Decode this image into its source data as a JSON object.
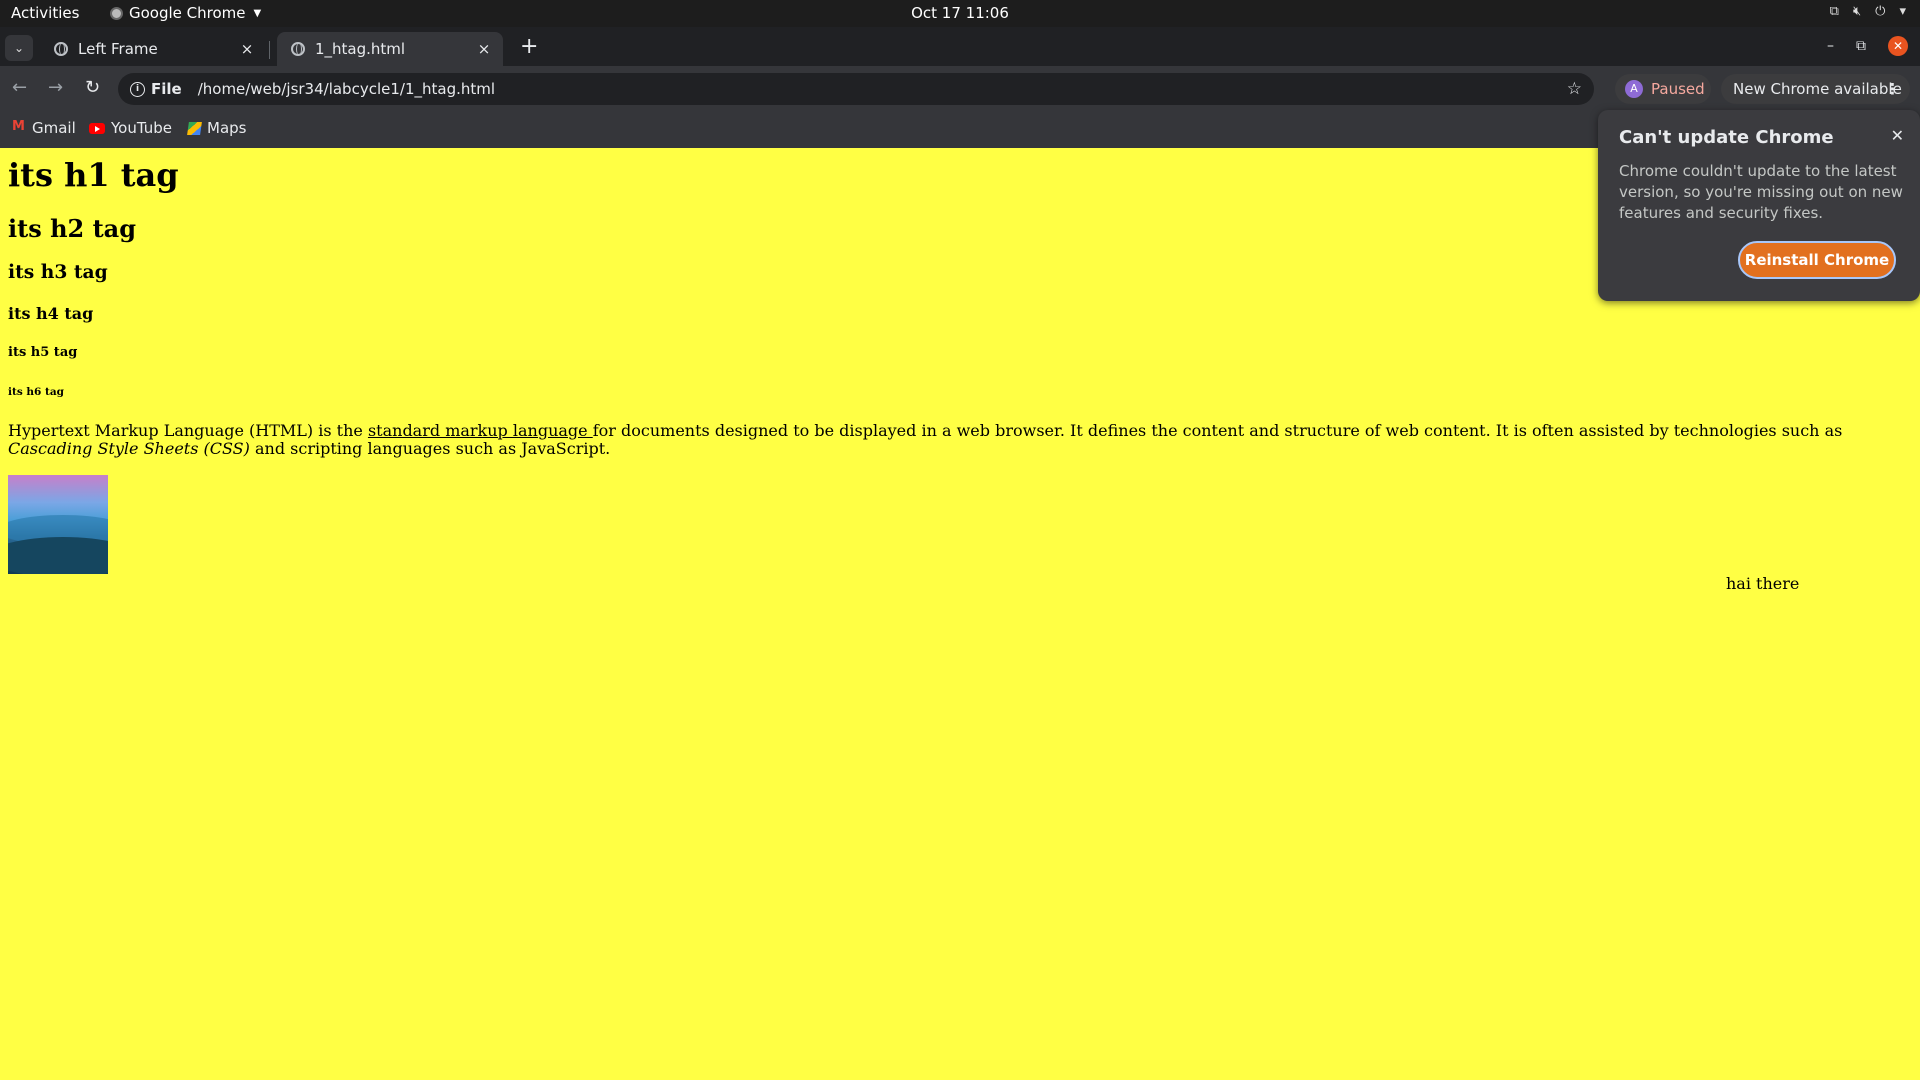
{
  "system_bar": {
    "activities": "Activities",
    "app_name": "Google Chrome",
    "datetime": "Oct 17  11:06"
  },
  "tabs": [
    {
      "title": "Left Frame",
      "close": "×"
    },
    {
      "title": "1_htag.html",
      "close": "×"
    }
  ],
  "toolbar": {
    "scheme": "File",
    "url": "/home/web/jsr34/labcycle1/1_htag.html",
    "profile_initial": "A",
    "profile_status": "Paused",
    "update_label": "New Chrome available"
  },
  "bookmarks": [
    {
      "label": "Gmail"
    },
    {
      "label": "YouTube"
    },
    {
      "label": "Maps"
    }
  ],
  "page": {
    "h1": "its h1 tag",
    "h2": "its h2 tag",
    "h3": "its h3 tag",
    "h4": "its h4 tag",
    "h5": "its h5 tag",
    "h6": "its h6 tag",
    "para_before_link": "Hypertext Markup Language (HTML) is the ",
    "para_link": "standard markup language ",
    "para_middle": "for documents designed to be displayed in a web browser. It defines the content and structure of web content. It is often assisted by technologies such as ",
    "para_italic": "Cascading Style Sheets (CSS)",
    "para_end": " and scripting languages such as JavaScript.",
    "side_text": "hai there",
    "background_color": "#ffff44"
  },
  "popup": {
    "title": "Can't update Chrome",
    "body": "Chrome couldn't update to the latest version, so you're missing out on new features and security fixes.",
    "button": "Reinstall Chrome",
    "accent_color": "#e2701f"
  }
}
